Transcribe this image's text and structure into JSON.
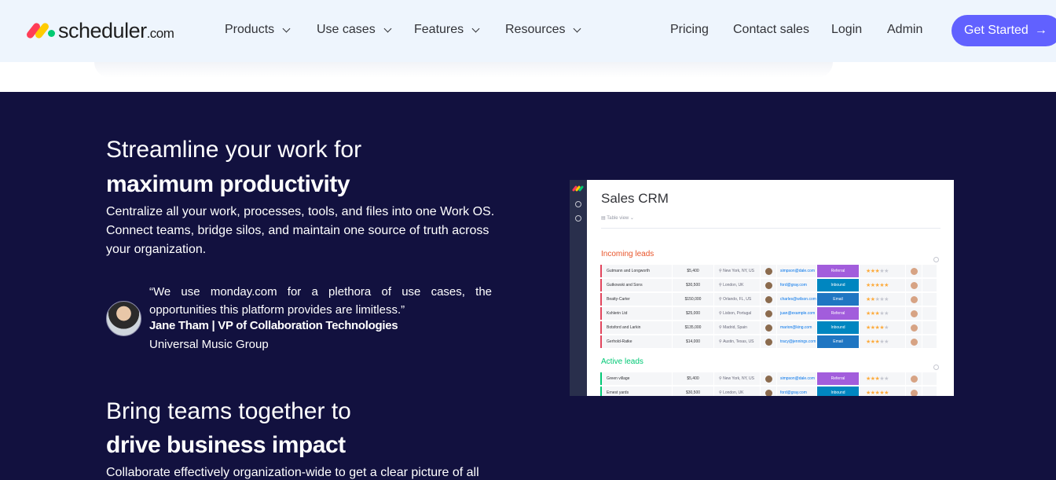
{
  "nav": {
    "logo_text": "scheduler",
    "logo_suffix": ".com",
    "items": [
      {
        "label": "Products"
      },
      {
        "label": "Use cases"
      },
      {
        "label": "Features"
      },
      {
        "label": "Resources"
      }
    ],
    "pricing": "Pricing",
    "contact_sales": "Contact sales",
    "login": "Login",
    "admin": "Admin",
    "cta": "Get Started",
    "cta_arrow": "→"
  },
  "hero": {
    "heading_light": "Streamline your work for",
    "heading_bold": "maximum productivity",
    "paragraph": "Centralize all your work, processes, tools, and files into one Work OS. Connect teams, bridge silos, and maintain one source of truth across your organization.",
    "quote": {
      "text": "“We use monday.com for a plethora of use cases, the opportunities this platform provides are limitless.”",
      "name": "Jane Tham | VP of Collaboration Technologies",
      "company": "Universal Music Group"
    }
  },
  "section2": {
    "heading_light": "Bring teams together to",
    "heading_bold": "drive business impact",
    "paragraph": "Collaborate effectively organization-wide to get a clear picture of all"
  },
  "crm": {
    "title": "Sales CRM",
    "view": "Table view",
    "colors": {
      "incoming": "#e2445c",
      "incoming_title": "#e8552b",
      "active": "#00c875",
      "active_title": "#00c875",
      "referral": "#a25ddc",
      "inbound": "#0086c0",
      "email": "#1f76c2"
    },
    "incoming_title": "Incoming leads",
    "incoming": [
      {
        "name": "Gutmann and Longworth",
        "value": "$5,400",
        "location": "New York, NY, US",
        "email": "simpson@dale.com",
        "source": "Referral",
        "stars": "★★★",
        "empty": "★★"
      },
      {
        "name": "Gutkowski and Sons",
        "value": "$30,500",
        "location": "London, UK",
        "email": "ford@gray.com",
        "source": "Inbound",
        "stars": "★★★★★",
        "empty": ""
      },
      {
        "name": "Beatty-Carter",
        "value": "$150,000",
        "location": "Orlando, FL, US",
        "email": "charles@wilson.com",
        "source": "Email",
        "stars": "★★",
        "empty": "★★★"
      },
      {
        "name": "Kshlerin Ltd",
        "value": "$25,000",
        "location": "Lisbon, Portugal",
        "email": "juan@example.com",
        "source": "Referral",
        "stars": "★★★",
        "empty": "★★"
      },
      {
        "name": "Botsford and Larkin",
        "value": "$135,000",
        "location": "Madrid, Spain",
        "email": "marion@king.com",
        "source": "Inbound",
        "stars": "★★★★",
        "empty": "★"
      },
      {
        "name": "Gerhold-Ratke",
        "value": "$14,000",
        "location": "Austin, Texas, US",
        "email": "tracy@jennings.com",
        "source": "Email",
        "stars": "★★★",
        "empty": "★★"
      }
    ],
    "active_title": "Active leads",
    "active": [
      {
        "name": "Green village",
        "value": "$5,400",
        "location": "New York, NY, US",
        "email": "simpson@dale.com",
        "source": "Referral",
        "stars": "★★★",
        "empty": "★★"
      },
      {
        "name": "Ernest yards",
        "value": "$30,500",
        "location": "London, UK",
        "email": "ford@gray.com",
        "source": "Inbound",
        "stars": "★★★★★",
        "empty": ""
      }
    ]
  }
}
